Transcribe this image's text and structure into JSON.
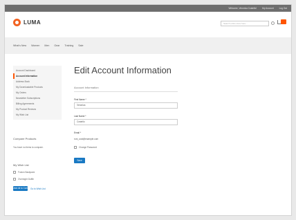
{
  "topbar": {
    "links": [
      "Welcome, Veronica Costello!",
      "My Account",
      "Log Out"
    ]
  },
  "header": {
    "logo_text": "LUMA",
    "search_placeholder": "Search entire store here...",
    "cart_count": "2"
  },
  "nav": {
    "items": [
      "What's New",
      "Women",
      "Men",
      "Gear",
      "Training",
      "Sale"
    ]
  },
  "sidebar": {
    "items": [
      {
        "label": "Account Dashboard"
      },
      {
        "label": "Account Information"
      },
      {
        "label": "Address Book"
      },
      {
        "label": "My Downloadable Products"
      },
      {
        "label": "My Orders"
      },
      {
        "label": "Newsletter Subscriptions"
      },
      {
        "label": "Billing Agreements"
      },
      {
        "label": "My Product Reviews"
      },
      {
        "label": "My Wish List"
      }
    ],
    "compare": {
      "title": "Compare Products",
      "text": "You have no items to compare."
    },
    "wishlist": {
      "title": "My Wish List",
      "items": [
        "Fusion Backpack",
        "Overnight Duffle"
      ],
      "add_all_label": "Add All to Cart",
      "go_to_label": "Go to Wish List"
    }
  },
  "main": {
    "title": "Edit Account Information",
    "section_title": "Account Information",
    "first_name": {
      "label": "First Name *",
      "value": "Veronica"
    },
    "last_name": {
      "label": "Last Name *",
      "value": "Costello"
    },
    "email": {
      "label": "Email *",
      "value": "roni_cost@example.com"
    },
    "change_password_label": "Change Password",
    "save_label": "Save"
  },
  "colors": {
    "accent": "#1979c3",
    "brand": "#f26322",
    "active_marker": "#ff5501"
  }
}
